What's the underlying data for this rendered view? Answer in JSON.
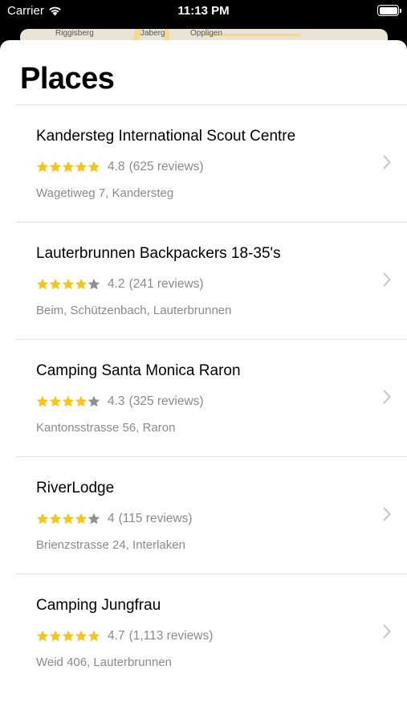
{
  "status_bar": {
    "carrier": "Carrier",
    "time": "11:13 PM"
  },
  "map": {
    "labels": [
      "Riggisberg",
      "Jaberg",
      "Oppligen"
    ]
  },
  "title": "Places",
  "colors": {
    "star_filled": "#f5c518",
    "star_empty": "#8e8e93",
    "secondary_text": "#8a8a8e",
    "separator": "#e2e2e6"
  },
  "places": [
    {
      "name": "Kandersteg International Scout Centre",
      "stars": 5,
      "rating": "4.8",
      "reviews": "(625 reviews)",
      "address": "Wagetiweg 7, Kandersteg"
    },
    {
      "name": "Lauterbrunnen Backpackers 18-35's",
      "stars": 4,
      "rating": "4.2",
      "reviews": "(241 reviews)",
      "address": "Beim, Schützenbach, Lauterbrunnen"
    },
    {
      "name": "Camping Santa Monica Raron",
      "stars": 4,
      "rating": "4.3",
      "reviews": "(325 reviews)",
      "address": "Kantonsstrasse 56, Raron"
    },
    {
      "name": "RiverLodge",
      "stars": 4,
      "rating": "4",
      "reviews": "(115 reviews)",
      "address": "Brienzstrasse 24, Interlaken"
    },
    {
      "name": "Camping Jungfrau",
      "stars": 5,
      "rating": "4.7",
      "reviews": "(1,113 reviews)",
      "address": "Weid 406, Lauterbrunnen"
    }
  ]
}
